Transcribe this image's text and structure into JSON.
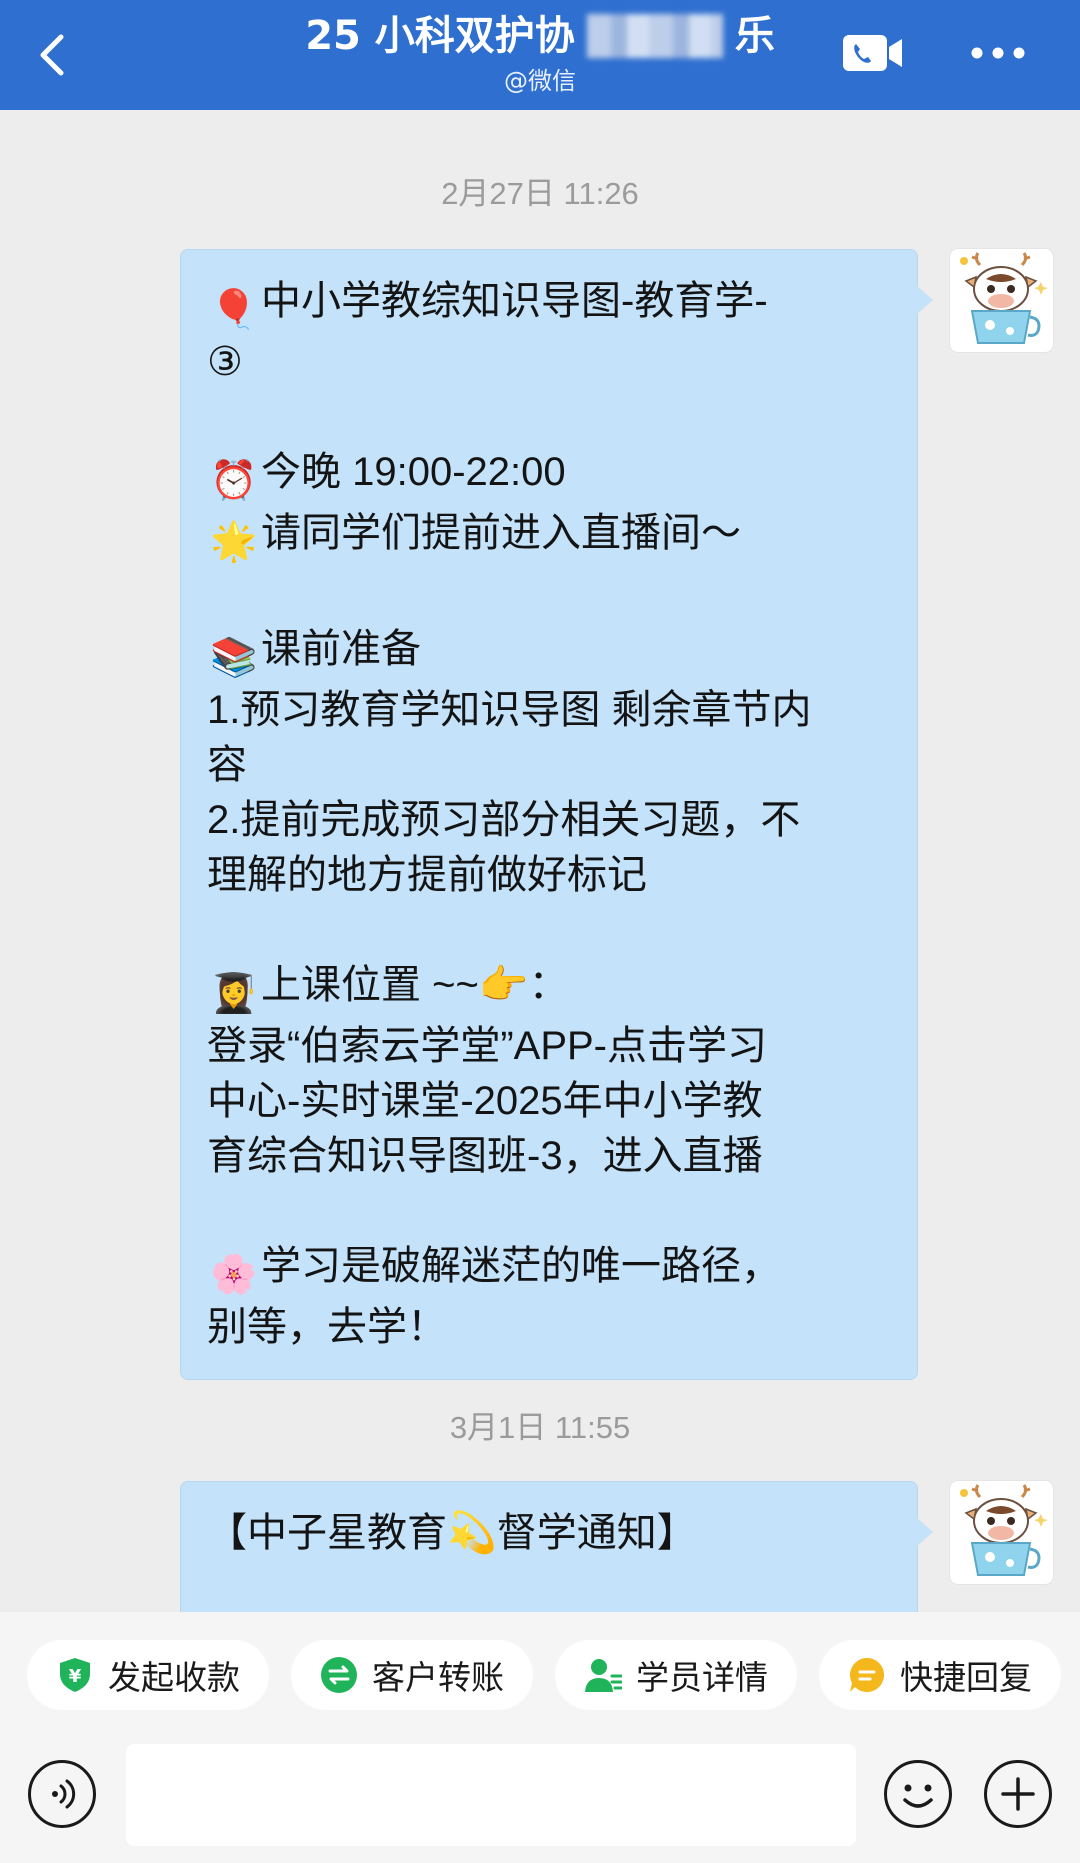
{
  "header": {
    "title_left": "25 小科双护协",
    "title_right": "乐",
    "subtitle": "@微信",
    "background": "#2f6fd0"
  },
  "icons": {
    "back": "chevron-left-icon",
    "video_call": "video-call-icon",
    "more": "more-dots-icon",
    "voice": "voice-input-icon",
    "emoji": "emoji-icon",
    "plus": "plus-icon"
  },
  "messages": [
    {
      "timestamp": "2月27日 11:26",
      "lines": [
        {
          "emoji": "🎈",
          "text": "中小学教综知识导图-教育学-"
        },
        {
          "emoji": "",
          "text": "③"
        },
        {
          "emoji": "",
          "text": ""
        },
        {
          "emoji": "⏰",
          "text": "今晚 19:00-22:00"
        },
        {
          "emoji": "🌟",
          "text": "请同学们提前进入直播间～"
        },
        {
          "emoji": "",
          "text": ""
        },
        {
          "emoji": "📚",
          "text": "课前准备"
        },
        {
          "emoji": "",
          "text": "1.预习教育学知识导图 剩余章节内"
        },
        {
          "emoji": "",
          "text": "容"
        },
        {
          "emoji": "",
          "text": "2.提前完成预习部分相关习题，不"
        },
        {
          "emoji": "",
          "text": "理解的地方提前做好标记"
        },
        {
          "emoji": "",
          "text": ""
        },
        {
          "emoji": "👩‍🎓",
          "text": "上课位置 ~~👉："
        },
        {
          "emoji": "",
          "text": "登录“伯索云学堂”APP-点击学习"
        },
        {
          "emoji": "",
          "text": "中心-实时课堂-2025年中小学教"
        },
        {
          "emoji": "",
          "text": "育综合知识导图班-3，进入直播"
        },
        {
          "emoji": "",
          "text": ""
        },
        {
          "emoji": "🌸",
          "text": "学习是破解迷茫的唯一路径，"
        },
        {
          "emoji": "",
          "text": "别等，去学！"
        }
      ]
    },
    {
      "timestamp": "3月1日 11:55",
      "lines": [
        {
          "emoji": "",
          "text": "【中子星教育💫督学通知】"
        }
      ]
    }
  ],
  "quick_actions": [
    {
      "label": "发起收款",
      "icon": "payment-shield-icon",
      "color": "#1fb45a"
    },
    {
      "label": "客户转账",
      "icon": "transfer-icon",
      "color": "#1fb45a"
    },
    {
      "label": "学员详情",
      "icon": "student-detail-icon",
      "color": "#1fb45a"
    },
    {
      "label": "快捷回复",
      "icon": "quick-reply-icon",
      "color": "#f4b71c"
    }
  ],
  "input": {
    "placeholder": ""
  }
}
